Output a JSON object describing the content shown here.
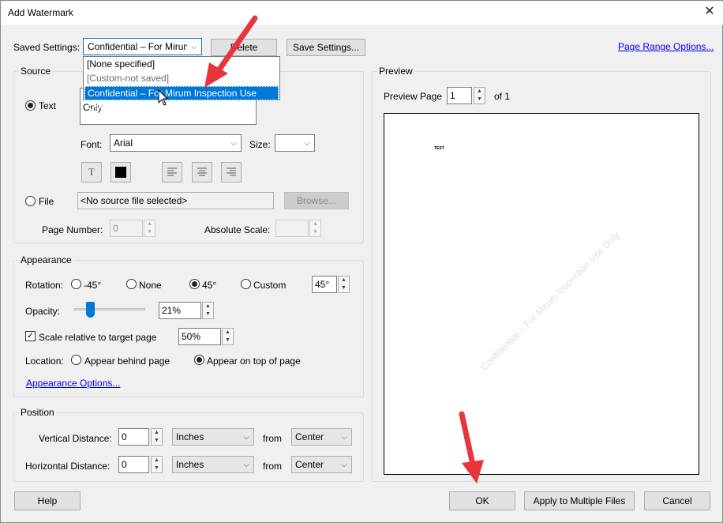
{
  "window": {
    "title": "Add Watermark",
    "close_glyph": "✕"
  },
  "saved_settings": {
    "label": "Saved Settings:",
    "value": "Confidential – For Mirum",
    "delete_label": "Delete",
    "save_label": "Save Settings...",
    "page_range_link": "Page Range Options...",
    "options": [
      "[None specified]",
      "[Custom-not saved]",
      "Confidential – For Mirum Inspection Use Only"
    ]
  },
  "source": {
    "group_label": "Source",
    "text_label": "Text",
    "text_value": "Only",
    "font_label": "Font:",
    "font_value": "Arial",
    "size_label": "Size:",
    "size_value": "",
    "file_label": "File",
    "file_value": "<No source file selected>",
    "browse_label": "Browse...",
    "page_number_label": "Page Number:",
    "page_number_value": "0",
    "absolute_scale_label": "Absolute Scale:",
    "absolute_scale_value": ""
  },
  "appearance": {
    "group_label": "Appearance",
    "rotation_label": "Rotation:",
    "rot_neg45": "-45°",
    "rot_none": "None",
    "rot_45": "45°",
    "rot_custom": "Custom",
    "custom_value": "45°",
    "opacity_label": "Opacity:",
    "opacity_value": "21%",
    "opacity_fraction": 0.21,
    "scale_label": "Scale relative to target page",
    "scale_value": "50%",
    "location_label": "Location:",
    "loc_behind": "Appear behind page",
    "loc_top": "Appear on top of page",
    "options_link": "Appearance Options..."
  },
  "position": {
    "group_label": "Position",
    "vertical_label": "Vertical Distance:",
    "vertical_value": "0",
    "vertical_unit": "Inches",
    "vertical_from_label": "from",
    "vertical_from": "Center",
    "horizontal_label": "Horizontal Distance:",
    "horizontal_value": "0",
    "horizontal_unit": "Inches",
    "horizontal_from_label": "from",
    "horizontal_from": "Center"
  },
  "preview": {
    "group_label": "Preview",
    "page_label": "Preview Page",
    "page_value": "1",
    "of_label": "of 1",
    "page_text": "TEST",
    "watermark_text": "Confidential – For Mirum Inspection Use Only"
  },
  "footer": {
    "help_label": "Help",
    "ok_label": "OK",
    "apply_label": "Apply to Multiple Files",
    "cancel_label": "Cancel"
  },
  "colors": {
    "accent": "#0078d7",
    "annotation_arrow": "#e8343b",
    "link": "#0000ee"
  }
}
